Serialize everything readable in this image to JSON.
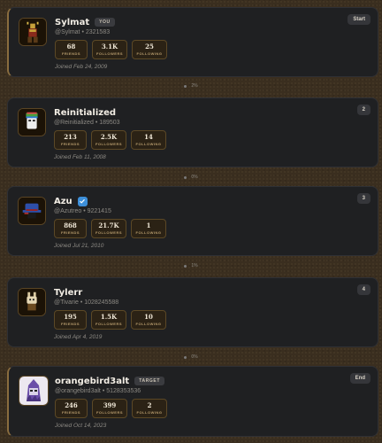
{
  "chain": [
    {
      "name": "Sylmat",
      "tag": "YOU",
      "handle": "@Sylmat",
      "id": "2321583",
      "stats": [
        {
          "value": "68",
          "label": "FRIENDS"
        },
        {
          "value": "3.1K",
          "label": "FOLLOWERS"
        },
        {
          "value": "25",
          "label": "FOLLOWING"
        }
      ],
      "joined": "Joined Feb 24, 2009",
      "badge": "Start"
    },
    {
      "name": "Reinitialized",
      "handle": "@Reinitialized",
      "id": "189503",
      "stats": [
        {
          "value": "213",
          "label": "FRIENDS"
        },
        {
          "value": "2.5K",
          "label": "FOLLOWERS"
        },
        {
          "value": "14",
          "label": "FOLLOWING"
        }
      ],
      "joined": "Joined Feb 11, 2008",
      "badge": "2"
    },
    {
      "name": "Azu",
      "verified": true,
      "handle": "@Azutreo",
      "id": "9221415",
      "stats": [
        {
          "value": "868",
          "label": "FRIENDS"
        },
        {
          "value": "21.7K",
          "label": "FOLLOWERS"
        },
        {
          "value": "1",
          "label": "FOLLOWING"
        }
      ],
      "joined": "Joined Jul 21, 2010",
      "badge": "3"
    },
    {
      "name": "Tylerr",
      "handle": "@Tivarie",
      "id": "1028245588",
      "stats": [
        {
          "value": "195",
          "label": "FRIENDS"
        },
        {
          "value": "1.5K",
          "label": "FOLLOWERS"
        },
        {
          "value": "10",
          "label": "FOLLOWING"
        }
      ],
      "joined": "Joined Apr 4, 2019",
      "badge": "4"
    },
    {
      "name": "orangebird3alt",
      "tag": "TARGET",
      "handle": "@orangebird3alt",
      "id": "5128353536",
      "stats": [
        {
          "value": "246",
          "label": "FRIENDS"
        },
        {
          "value": "399",
          "label": "FOLLOWERS"
        },
        {
          "value": "2",
          "label": "FOLLOWING"
        }
      ],
      "joined": "Joined Oct 14, 2023",
      "badge": "End"
    }
  ],
  "connectors": [
    "2%",
    "0%",
    "1%",
    "0%"
  ],
  "separator": "•",
  "colors": {
    "card_bg": "#1f2022",
    "stat_bg": "#2b2215",
    "stat_border": "#5b4826",
    "verified": "#3d8fd9",
    "page_bg": "#3a2e1f"
  }
}
